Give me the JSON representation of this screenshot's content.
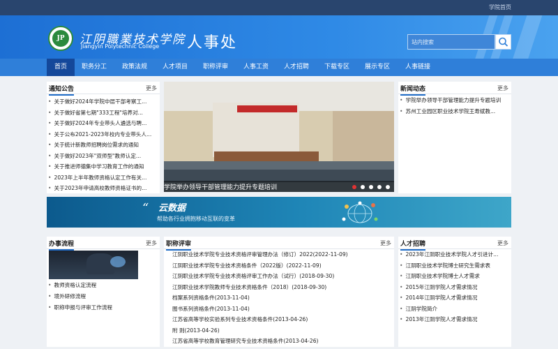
{
  "top": {
    "home_link": "学院首页"
  },
  "header": {
    "logo_mark": "JP",
    "school_name_cn": "江阴職業技术学院",
    "school_name_en": "Jiangyin Polytechnic College",
    "dept_name": "人事处",
    "search_placeholder": "站内搜索"
  },
  "nav": [
    {
      "label": "首页",
      "active": true
    },
    {
      "label": "职务分工"
    },
    {
      "label": "政策法规"
    },
    {
      "label": "人才项目"
    },
    {
      "label": "职称评审"
    },
    {
      "label": "人事工资"
    },
    {
      "label": "人才招聘"
    },
    {
      "label": "下载专区"
    },
    {
      "label": "展示专区"
    },
    {
      "label": "人事链接"
    }
  ],
  "notice": {
    "title": "通知公告",
    "more": "更多",
    "items": [
      "关于做好2024年学院中层干部考察工...",
      "关于做好省第七期\"333工程\"培养对...",
      "关于做好2024年专业带头人遴选与聘...",
      "关于公布2021-2023年校内专业带头人...",
      "关于统计新教师招聘岗位需求的通知",
      "关于做好2023年\"双师型\"教师认定...",
      "关于推进师德集中学习教育工作的通知",
      "2023年上半年教师资格认定工作有关...",
      "关于2023年申请高校教师资格证书的..."
    ]
  },
  "slider": {
    "caption": "学院举办领导干部管理能力提升专题培训",
    "banner_text": "学院举办领导干部管理能力提升专题培训",
    "dot_count": 5,
    "active_dot": 0
  },
  "news": {
    "title": "新闻动态",
    "more": "更多",
    "items": [
      "学院举办领导干部管理能力提升专题培训",
      "苏州工业园区职业技术学院王寿斌教..."
    ]
  },
  "ad": {
    "brand": "云数据",
    "tagline": "帮助各行业拥抱移动互联的变革"
  },
  "process": {
    "title": "办事流程",
    "more": "更多",
    "items": [
      "教师资格认定流程",
      "境外研修流程",
      "职称申报与评审工作流程"
    ]
  },
  "titles": {
    "title": "职称评审",
    "more": "更多",
    "items": [
      "江阴职业技术学院专业技术资格评审管理办法（修订）2022(2022-11-09)",
      "江阴职业技术学院专业技术资格条件（2022版）(2022-11-09)",
      "江阴职业技术学院专业技术资格评审工作办法（试行）(2018-09-30)",
      "江阴职业技术学院教师专业技术资格条件（2018）(2018-09-30)",
      "档案系列资格条件(2013-11-04)",
      "图书系列资格条件(2013-11-04)",
      "江苏省高等学校实验系列专业技术资格条件(2013-04-26)",
      "附 则(2013-04-26)",
      "江苏省高等学校教育管理研究专业技术资格条件(2013-04-26)"
    ]
  },
  "recruit": {
    "title": "人才招聘",
    "more": "更多",
    "items": [
      "2023年江阴职业技术学院人才引进计...",
      "江阴职业技术学院博士研究生需求表",
      "江阴职业技术学院博士人才需求",
      "2015年江阴学院人才需求情况",
      "2014年江阴学院人才需求情况",
      "江阴学院简介",
      "2013年江阴学院人才需求情况"
    ]
  }
}
